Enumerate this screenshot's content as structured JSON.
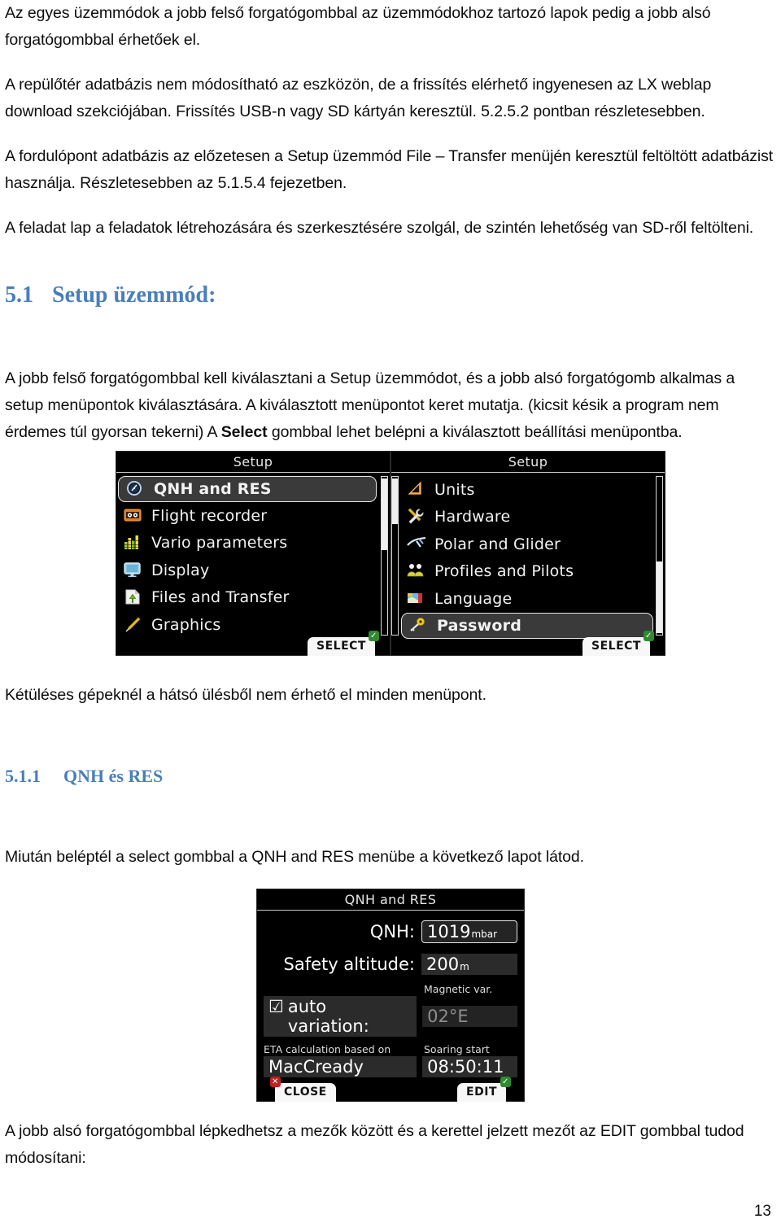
{
  "document": {
    "page_number": "13",
    "paragraphs": {
      "p1": "Az egyes üzemmódok a jobb felső forgatógombbal az üzemmódokhoz tartozó lapok pedig a jobb alsó forgatógombbal érhetőek el.",
      "p2": "A repülőtér adatbázis nem módosítható az eszközön, de a frissítés elérhető ingyenesen az LX weblap download szekciójában. Frissítés USB-n vagy SD kártyán keresztül. 5.2.5.2 pontban részletesebben.",
      "p3": "A fordulópont adatbázis az előzetesen a Setup üzemmód File – Transfer menüjén keresztül feltöltött adatbázist használja. Részletesebben az 5.1.5.4 fejezetben.",
      "p4": "A feladat lap a feladatok létrehozására és szerkesztésére szolgál, de szintén lehetőség van SD-ről feltölteni.",
      "p5_a": "A jobb felső forgatógombbal kell kiválasztani a Setup üzemmódot, és a jobb alsó forgatógomb alkalmas a setup menüpontok kiválasztására.  A kiválasztott menüpontot keret mutatja. (kicsit késik a program nem érdemes túl gyorsan tekerni) A ",
      "p5_bold": "Select",
      "p5_b": " gombbal lehet belépni a kiválasztott beállítási menüpontba.",
      "p6": "Kétüléses gépeknél a hátsó ülésből nem érhető el minden menüpont.",
      "p7": "Miután beléptél a select gombbal a QNH and RES menübe a következő lapot látod.",
      "p8": "A jobb alsó forgatógombbal lépkedhetsz a mezők között és a kerettel jelzett mezőt az EDIT gombbal tudod módosítani:"
    },
    "headings": {
      "h_5_1_num": "5.1",
      "h_5_1_text": "Setup üzemmód:",
      "h_5_1_1_num": "5.1.1",
      "h_5_1_1_text": "QNH és RES"
    },
    "heading_color": "#4a7ebb"
  },
  "setup_screen_left": {
    "title": "Setup",
    "items": [
      {
        "label": "QNH and RES",
        "icon": "compass-icon",
        "selected": true
      },
      {
        "label": "Flight recorder",
        "icon": "flight-recorder-icon",
        "selected": false
      },
      {
        "label": "Vario parameters",
        "icon": "bargraph-icon",
        "selected": false
      },
      {
        "label": "Display",
        "icon": "monitor-icon",
        "selected": false
      },
      {
        "label": "Files and Transfer",
        "icon": "file-transfer-icon",
        "selected": false
      },
      {
        "label": "Graphics",
        "icon": "paintbrush-icon",
        "selected": false
      }
    ],
    "softkey": "SELECT"
  },
  "setup_screen_right": {
    "title": "Setup",
    "items": [
      {
        "label": "Units",
        "icon": "triangle-ruler-icon",
        "selected": false
      },
      {
        "label": "Hardware",
        "icon": "tools-icon",
        "selected": false
      },
      {
        "label": "Polar and Glider",
        "icon": "glider-icon",
        "selected": false
      },
      {
        "label": "Profiles and Pilots",
        "icon": "people-icon",
        "selected": false
      },
      {
        "label": "Language",
        "icon": "flag-icon",
        "selected": false
      },
      {
        "label": "Password",
        "icon": "key-icon",
        "selected": true
      }
    ],
    "softkey": "SELECT"
  },
  "qnh_screen": {
    "title": "QNH and RES",
    "qnh_label": "QNH:",
    "qnh_value": "1019",
    "qnh_unit": "mbar",
    "safety_label": "Safety altitude:",
    "safety_value": "200",
    "safety_unit": "m",
    "magvar_caption": "Magnetic var.",
    "magvar_value": "02°E",
    "autovar_label": "auto variation:",
    "autovar_checked": "☑",
    "eta_caption": "ETA calculation based on",
    "eta_value": "MacCready",
    "soaring_caption": "Soaring start",
    "soaring_value": "08:50:11",
    "close_label": "CLOSE",
    "edit_label": "EDIT"
  }
}
